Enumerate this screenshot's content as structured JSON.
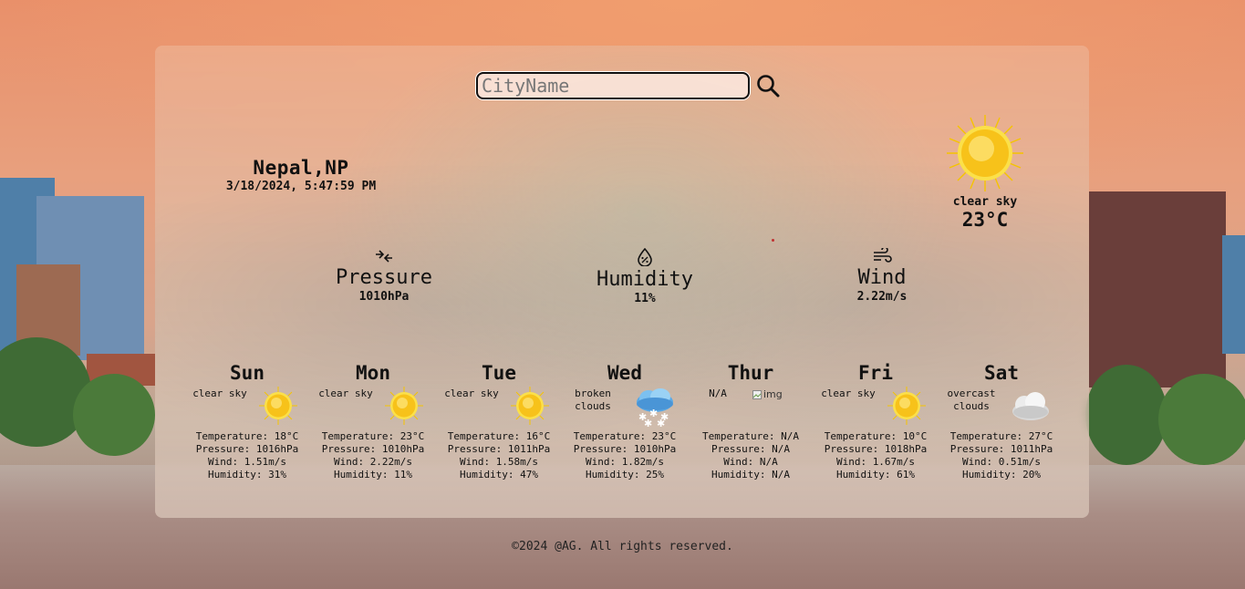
{
  "search": {
    "placeholder": "CityName"
  },
  "location": {
    "city": "Nepal,NP",
    "datetime": "3/18/2024, 5:47:59 PM"
  },
  "current": {
    "description": "clear sky",
    "temperature": "23°C",
    "icon": "sun-icon"
  },
  "stats": {
    "pressure": {
      "title": "Pressure",
      "value": "1010hPa",
      "icon": "pressure-arrows-icon"
    },
    "humidity": {
      "title": "Humidity",
      "value": "11%",
      "icon": "humidity-drop-icon"
    },
    "wind": {
      "title": "Wind",
      "value": "2.22m/s",
      "icon": "wind-icon"
    }
  },
  "forecast": [
    {
      "day": "Sun",
      "desc": "clear sky",
      "icon": "sun-icon",
      "temperature": "Temperature: 18°C",
      "pressure": "Pressure: 1016hPa",
      "wind": "Wind: 1.51m/s",
      "humidity": "Humidity: 31%"
    },
    {
      "day": "Mon",
      "desc": "clear sky",
      "icon": "sun-icon",
      "temperature": "Temperature: 23°C",
      "pressure": "Pressure: 1010hPa",
      "wind": "Wind: 2.22m/s",
      "humidity": "Humidity: 11%"
    },
    {
      "day": "Tue",
      "desc": "clear sky",
      "icon": "sun-icon",
      "temperature": "Temperature: 16°C",
      "pressure": "Pressure: 1011hPa",
      "wind": "Wind: 1.58m/s",
      "humidity": "Humidity: 47%"
    },
    {
      "day": "Wed",
      "desc": "broken clouds",
      "icon": "snow-cloud-icon",
      "temperature": "Temperature: 23°C",
      "pressure": "Pressure: 1010hPa",
      "wind": "Wind: 1.82m/s",
      "humidity": "Humidity: 25%"
    },
    {
      "day": "Thur",
      "desc": "N/A",
      "icon": "broken-image-icon",
      "img_alt": "img",
      "temperature": "Temperature: N/A",
      "pressure": "Pressure: N/A",
      "wind": "Wind: N/A",
      "humidity": "Humidity: N/A"
    },
    {
      "day": "Fri",
      "desc": "clear sky",
      "icon": "sun-icon",
      "temperature": "Temperature: 10°C",
      "pressure": "Pressure: 1018hPa",
      "wind": "Wind: 1.67m/s",
      "humidity": "Humidity: 61%"
    },
    {
      "day": "Sat",
      "desc": "overcast clouds",
      "icon": "cloud-icon",
      "temperature": "Temperature: 27°C",
      "pressure": "Pressure: 1011hPa",
      "wind": "Wind: 0.51m/s",
      "humidity": "Humidity: 20%"
    }
  ],
  "footer": {
    "text": "©2024 @AG. All rights reserved."
  },
  "colors": {
    "panel": "#f0c8b4",
    "text": "#111111",
    "sun": "#f7c21a"
  }
}
